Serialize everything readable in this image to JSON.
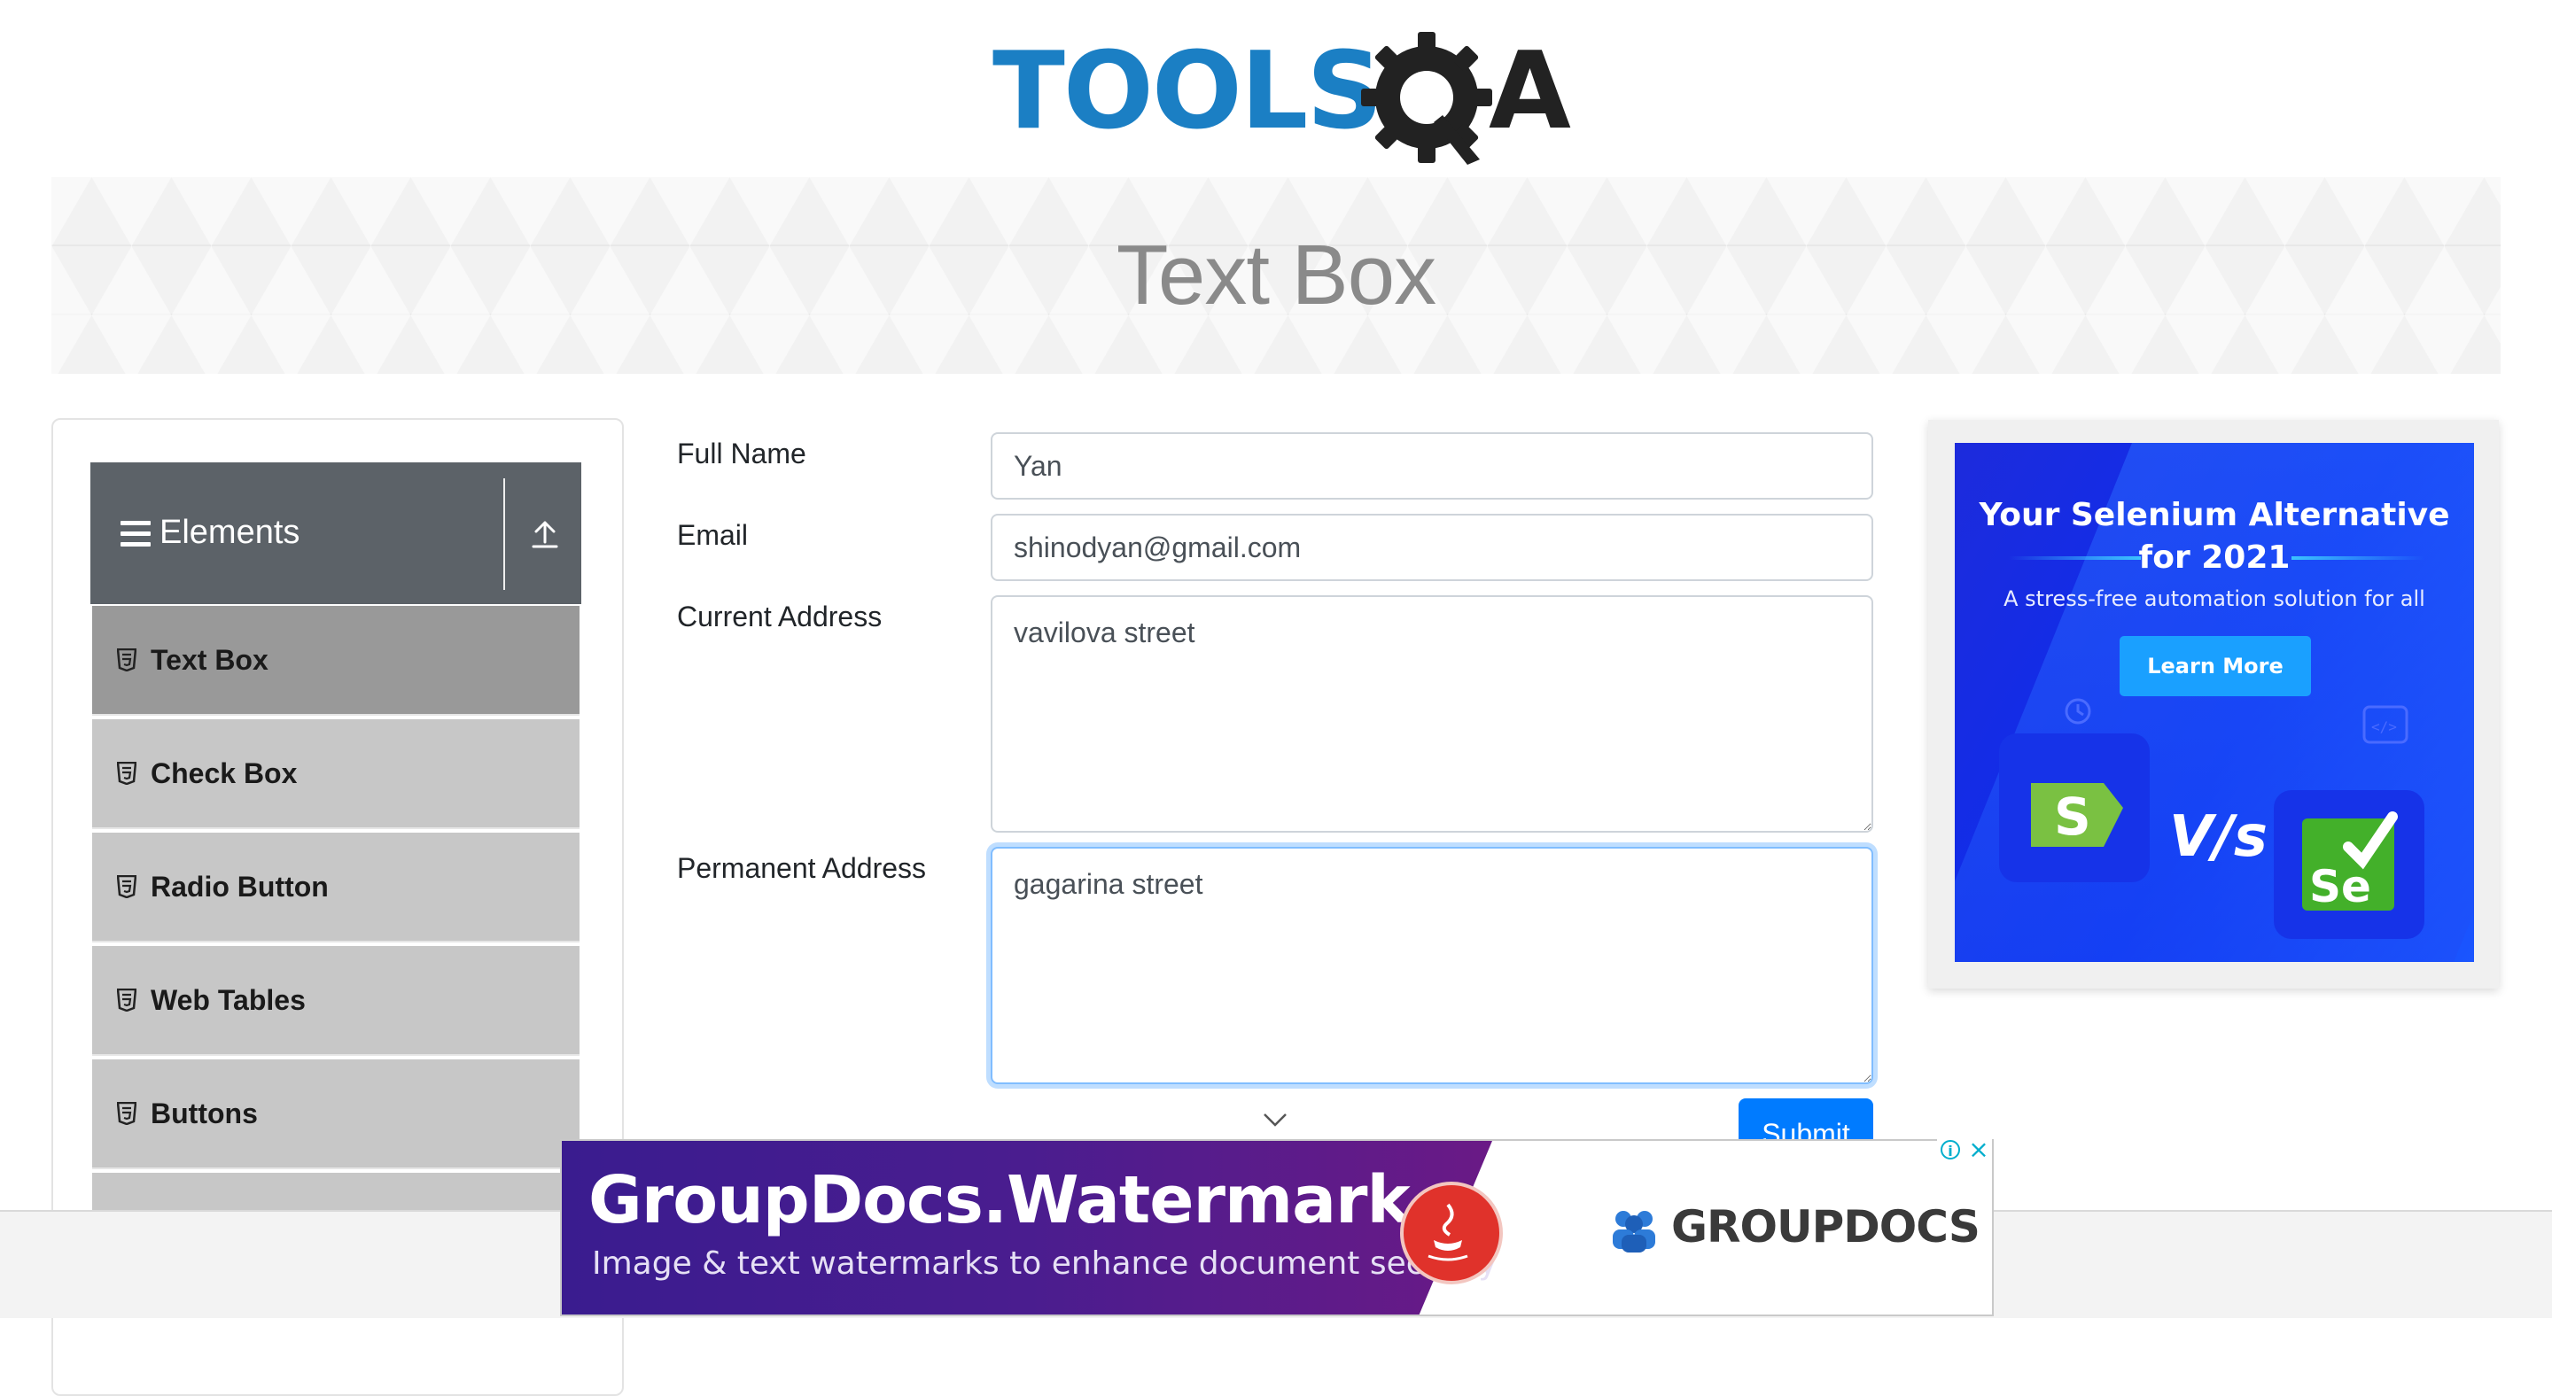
{
  "header": {
    "logo_text_left": "TOOLS",
    "logo_text_right": "A"
  },
  "banner": {
    "title": "Text Box"
  },
  "sidebar": {
    "group_title": "Elements",
    "items": [
      {
        "label": "Text Box",
        "active": true
      },
      {
        "label": "Check Box",
        "active": false
      },
      {
        "label": "Radio Button",
        "active": false
      },
      {
        "label": "Web Tables",
        "active": false
      },
      {
        "label": "Buttons",
        "active": false
      }
    ]
  },
  "form": {
    "full_name": {
      "label": "Full Name",
      "value": "Yan"
    },
    "email": {
      "label": "Email",
      "value": "shinodyan@gmail.com"
    },
    "current_address": {
      "label": "Current Address",
      "value": "vavilova street"
    },
    "permanent_address": {
      "label": "Permanent Address",
      "value": "gagarina street"
    },
    "submit_label": "Submit"
  },
  "right_ad": {
    "headline_line1": "Your Selenium Alternative",
    "headline_line2": "for 2021",
    "subtext": "A stress-free automation solution for all",
    "cta": "Learn More",
    "vs_text": "V/s",
    "left_logo_letter": "S",
    "right_logo_text": "Se"
  },
  "bottom_ad": {
    "title": "GroupDocs.Watermark",
    "subtitle": "Image & text watermarks to enhance document security",
    "brand": "GROUPDOCS"
  },
  "colors": {
    "primary": "#007bff",
    "sidebar_header": "#5c6268",
    "menu_item": "#c7c7c7",
    "menu_item_active": "#999999",
    "logo_blue": "#1b7fc4"
  }
}
